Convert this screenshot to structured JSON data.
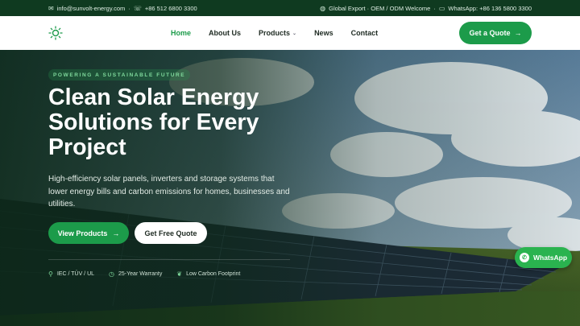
{
  "topbar": {
    "email": "info@sunvolt-energy.com",
    "phone": "+86 512 6800 3300",
    "export": "Global Export · OEM / ODM Welcome",
    "whatsapp": "WhatsApp: +86 136 5800 3300",
    "mail_icon": "mail-icon",
    "phone_icon": "phone-icon",
    "globe_icon": "globe-icon",
    "chat_icon": "chat-icon"
  },
  "nav": {
    "logo_icon": "sun-icon",
    "items": [
      {
        "label": "Home"
      },
      {
        "label": "About Us"
      },
      {
        "label": "Products"
      },
      {
        "label": "News"
      },
      {
        "label": "Contact"
      }
    ],
    "cta": "Get a Quote"
  },
  "hero": {
    "eyebrow": "POWERING A SUSTAINABLE FUTURE",
    "title": "Clean Solar Energy Solutions for Every Project",
    "lead": "High-efficiency solar panels, inverters and storage systems that lower energy bills and carbon emissions for homes, businesses and utilities.",
    "primary_button": "View Products",
    "secondary_button": "Get Free Quote",
    "badges": [
      {
        "icon": "certificate-icon",
        "label": "IEC / TÜV / UL"
      },
      {
        "icon": "clock-icon",
        "label": "25-Year Warranty"
      },
      {
        "icon": "leaf-icon",
        "label": "Low Carbon Footprint"
      }
    ]
  },
  "whatsapp_float": {
    "label": "WhatsApp"
  },
  "colors": {
    "accent": "#1c9b4a",
    "topbar": "#0f3a20",
    "whatsapp": "#2ab34f"
  }
}
